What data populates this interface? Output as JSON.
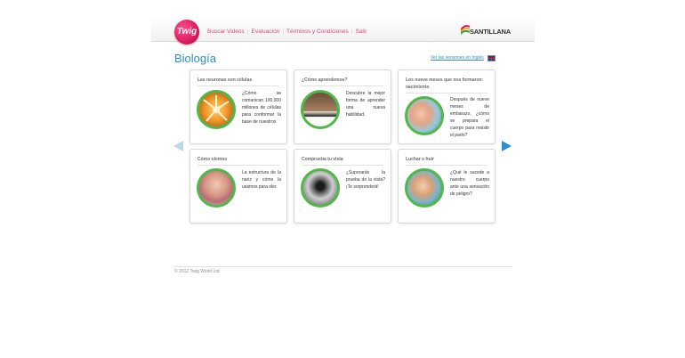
{
  "header": {
    "logo_text": "Twig",
    "nav": [
      "Buscar Videos",
      "Evaluación",
      "Términos y Condiciones",
      "Salir"
    ],
    "brand": "SANTILLANA"
  },
  "page": {
    "title": "Biología",
    "lang_link": "Ver las versiones en Inglés"
  },
  "cards": [
    {
      "title": "Las neuronas son células",
      "desc": "¿Cómo se comunican 100.000 millones de células para conformar la base de nuestros"
    },
    {
      "title": "¿Cómo aprendemos?",
      "desc": "Descubre la mejor forma de aprender una nueva habilidad."
    },
    {
      "title": "Los nueve meses que nos formaron: nacimiento",
      "desc": "Después de nueve meses de embarazo, ¿cómo se prepara el cuerpo para resistir el parto?"
    },
    {
      "title": "Cómo olemos",
      "desc": "La estructura de la nariz y cómo la usamos para oler."
    },
    {
      "title": "Comprueba tu vista",
      "desc": "¿Superarás la prueba de la vista? ¡Te sorprenderá!"
    },
    {
      "title": "Luchar o huir",
      "desc": "¿Qué le sucede a nuestro cuerpo ante una sensación de peligro?"
    }
  ],
  "footer": {
    "copyright": "© 2012 Twig World Ltd"
  }
}
